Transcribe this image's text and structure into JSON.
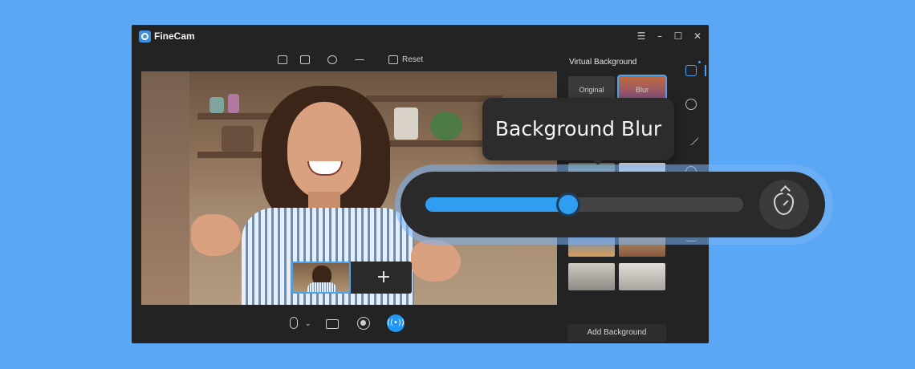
{
  "app": {
    "title": "FineCam"
  },
  "window_controls": [
    {
      "name": "menu-icon",
      "glyph": "☰"
    },
    {
      "name": "minimize-icon",
      "glyph": "–"
    },
    {
      "name": "maximize-icon",
      "glyph": "☐"
    },
    {
      "name": "close-icon",
      "glyph": "✕"
    }
  ],
  "toolbar": {
    "items": [
      "mirror-icon",
      "hd-icon",
      "contrast-icon",
      "flip-icon"
    ],
    "reset_label": "Reset"
  },
  "preview_strip": {
    "add_label": "+"
  },
  "controls": {
    "mic_chevron": "⌄",
    "live_glyph": "((•))"
  },
  "panel": {
    "title": "Virtual Background",
    "backgrounds": [
      {
        "label": "Original",
        "selected": false,
        "colors": [
          "#3a3a3a",
          "#3a3a3a"
        ]
      },
      {
        "label": "Blur",
        "selected": true,
        "colors": [
          "#c06a3a",
          "#7a4a8a"
        ]
      },
      {
        "label": "",
        "selected": false,
        "colors": [
          "#6c7a68",
          "#cfc9b8"
        ]
      },
      {
        "label": "",
        "selected": false,
        "colors": [
          "#e6e6e6",
          "#bdbdbd"
        ]
      },
      {
        "label": "",
        "selected": false,
        "colors": [
          "#8a6a58",
          "#5a4a40"
        ]
      },
      {
        "label": "",
        "selected": false,
        "colors": [
          "#c9c2b8",
          "#6a6460"
        ]
      },
      {
        "label": "",
        "selected": false,
        "colors": [
          "#3d7bd0",
          "#d9a05a"
        ]
      },
      {
        "label": "",
        "selected": false,
        "colors": [
          "#b8a07c",
          "#8c5a3c"
        ]
      },
      {
        "label": "",
        "selected": false,
        "colors": [
          "#cfcbc3",
          "#8d8a83"
        ]
      },
      {
        "label": "",
        "selected": false,
        "colors": [
          "#e0ddd8",
          "#a9a59d"
        ]
      }
    ],
    "add_background": "Add Background"
  },
  "side_tabs": [
    "portrait-icon",
    "filters-icon",
    "magic-wand-icon",
    "record-icon",
    "adjust-icon"
  ],
  "tooltip": {
    "text": "Background Blur"
  },
  "blur_slider": {
    "value": 0.45,
    "accent": "#2f9ef0"
  }
}
